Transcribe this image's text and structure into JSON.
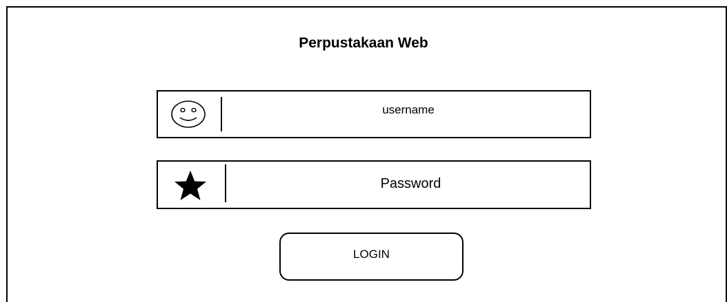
{
  "app": {
    "title": "Perpustakaan Web"
  },
  "form": {
    "username": {
      "placeholder": "username",
      "icon": "smiley-face-icon"
    },
    "password": {
      "placeholder": "Password",
      "icon": "star-icon"
    },
    "login_label": "LOGIN"
  }
}
